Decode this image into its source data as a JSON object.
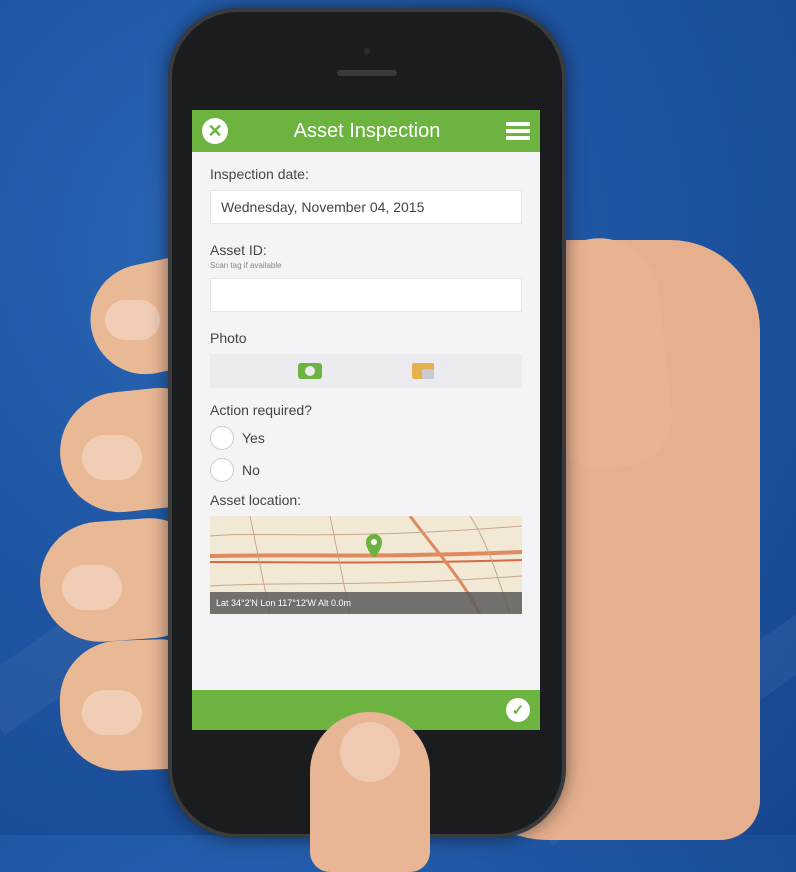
{
  "app": {
    "title": "Asset Inspection"
  },
  "form": {
    "inspection_date_label": "Inspection date:",
    "inspection_date_value": "Wednesday, November 04, 2015",
    "asset_id_label": "Asset ID:",
    "asset_id_hint": "Scan tag if available",
    "asset_id_value": "",
    "photo_label": "Photo",
    "action_label": "Action required?",
    "options": [
      "Yes",
      "No"
    ],
    "location_label": "Asset location:",
    "coordinates": "Lat 34°2'N Lon 117°12'W Alt 0.0m"
  },
  "icons": {
    "close": "close-icon",
    "menu": "hamburger-menu-icon",
    "camera": "camera-icon",
    "folder": "folder-icon",
    "pin": "map-pin-icon",
    "check": "check-icon"
  },
  "colors": {
    "accent": "#6db33f",
    "background": "#1f56a3"
  }
}
